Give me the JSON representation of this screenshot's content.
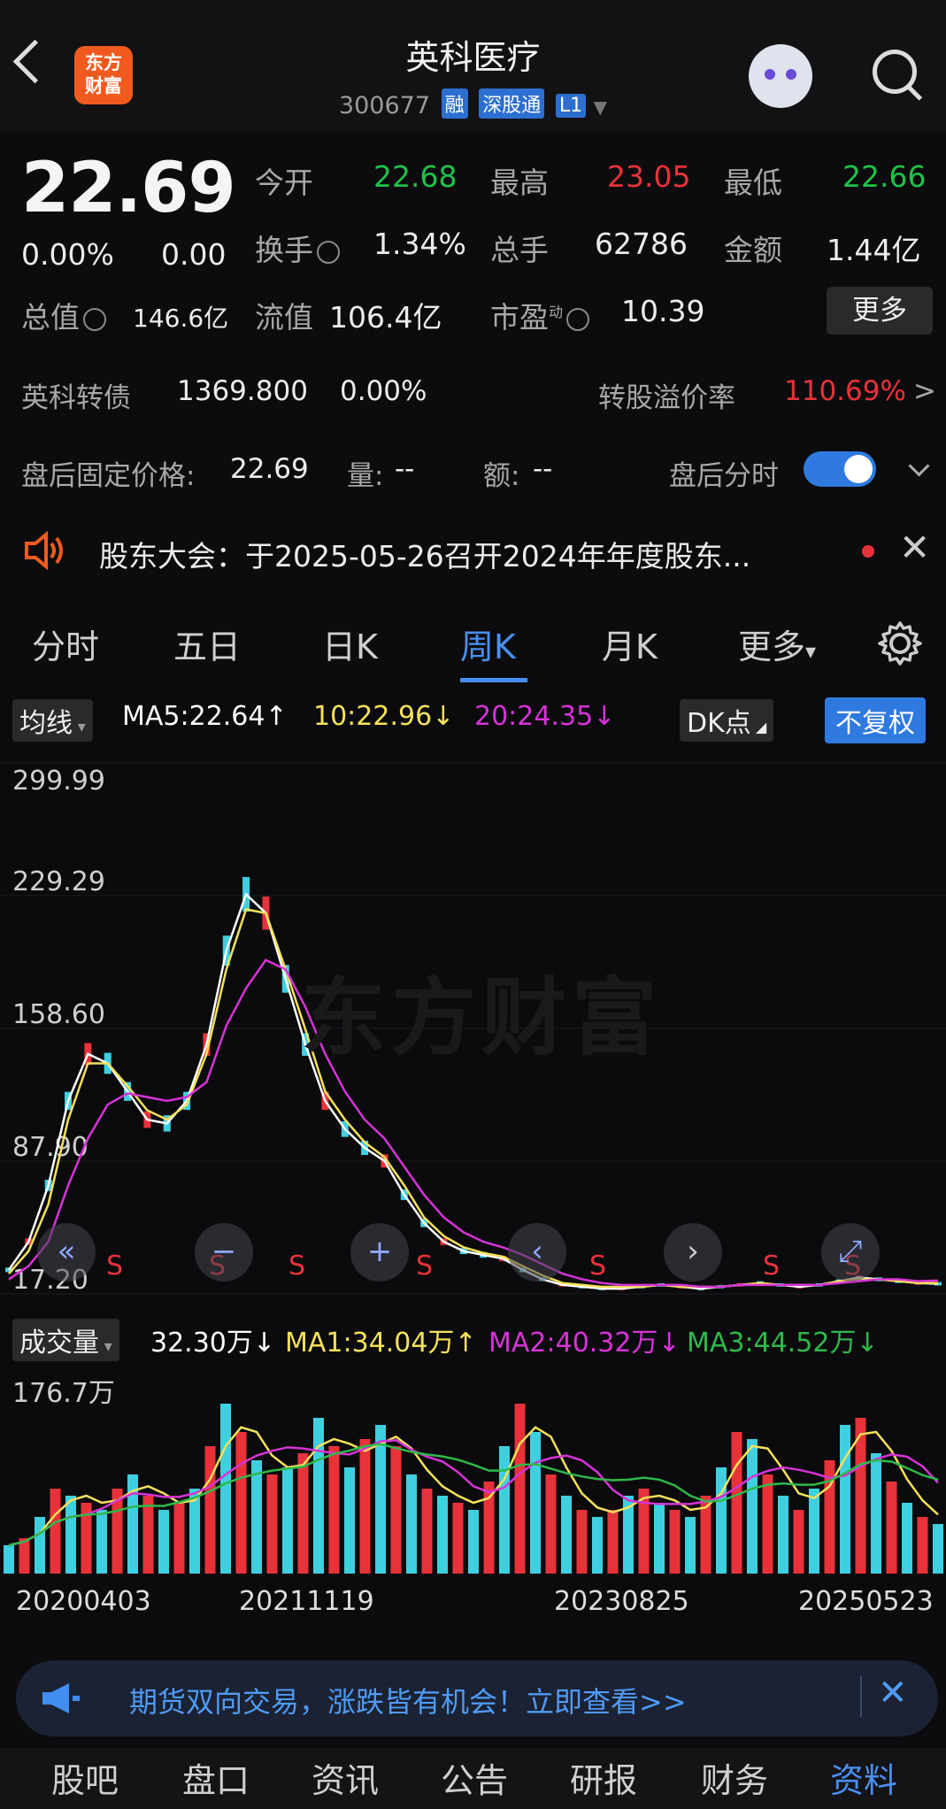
{
  "header": {
    "title": "英科医疗",
    "code": "300677",
    "tags": [
      "融",
      "深股通",
      "L1"
    ],
    "logo_line1": "东方",
    "logo_line2": "财富"
  },
  "quote": {
    "price": "22.69",
    "change_pct": "0.00%",
    "change": "0.00",
    "open_label": "今开",
    "open": "22.68",
    "high_label": "最高",
    "high": "23.05",
    "low_label": "最低",
    "low": "22.66",
    "turnover_label": "换手",
    "turnover": "1.34%",
    "volume_label": "总手",
    "volume": "62786",
    "amount_label": "金额",
    "amount": "1.44亿",
    "mktcap_label": "总值",
    "mktcap": "146.6亿",
    "float_label": "流值",
    "float": "106.4亿",
    "pe_label": "市盈",
    "pe_sup": "动",
    "pe": "10.39",
    "more": "更多"
  },
  "bond": {
    "name": "英科转债",
    "price": "1369.800",
    "pct": "0.00%",
    "premium_label": "转股溢价率",
    "premium": "110.69%",
    "arrow": ">"
  },
  "afterhours": {
    "price_label": "盘后固定价格:",
    "price": "22.69",
    "vol_label": "量:",
    "vol": "--",
    "amt_label": "额:",
    "amt": "--",
    "minute_label": "盘后分时"
  },
  "notice": {
    "text": "股东大会：于2025-05-26召开2024年年度股东..."
  },
  "tabs": [
    "分时",
    "五日",
    "日K",
    "周K",
    "月K",
    "更多"
  ],
  "active_tab": "周K",
  "tab_more_arrow": "▾",
  "chart_header": {
    "indicator": "均线",
    "ma5": "MA5:22.64↑",
    "ma10": "10:22.96↓",
    "ma20": "20:24.35↓",
    "dk": "DK点",
    "adjust": "不复权"
  },
  "vol_header": {
    "indicator": "成交量",
    "vol": "32.30万↓",
    "ma1": "MA1:34.04万↑",
    "ma2": "MA2:40.32万↓",
    "ma3": "MA3:44.52万↓"
  },
  "colors": {
    "up": "#e8323a",
    "down": "#3fd0e0",
    "ma5": "#ffffff",
    "ma10": "#f5e15a",
    "ma20": "#d633d6",
    "ma3": "#2fb84a",
    "accent": "#2f7ae0"
  },
  "chart_data": {
    "type": "line",
    "title": "",
    "y_ticks": [
      "299.99",
      "229.29",
      "158.60",
      "87.90",
      "17.20"
    ],
    "ylim": [
      17.2,
      299.99
    ],
    "x_dates": [
      "20200403",
      "20211119",
      "20230825",
      "20250523"
    ],
    "series": [
      {
        "name": "MA5",
        "values": [
          30,
          45,
          75,
          120,
          145,
          140,
          125,
          110,
          108,
          120,
          150,
          200,
          230,
          220,
          185,
          150,
          120,
          105,
          95,
          88,
          70,
          55,
          45,
          40,
          38,
          36,
          30,
          25,
          22,
          21,
          20,
          20,
          21,
          22,
          21,
          20,
          21,
          22,
          23,
          22,
          21,
          22,
          24,
          26,
          25,
          24,
          23,
          22.6
        ]
      },
      {
        "name": "10",
        "values": [
          28,
          40,
          65,
          110,
          140,
          140,
          128,
          115,
          110,
          118,
          145,
          190,
          222,
          220,
          190,
          158,
          125,
          110,
          98,
          90,
          75,
          58,
          48,
          42,
          39,
          37,
          32,
          27,
          23,
          22,
          21,
          21,
          21,
          22,
          21,
          21,
          21,
          22,
          23,
          22,
          22,
          22,
          24,
          25,
          25,
          24,
          23,
          23
        ]
      },
      {
        "name": "20",
        "values": [
          25,
          32,
          45,
          75,
          100,
          118,
          124,
          122,
          120,
          122,
          130,
          160,
          180,
          195,
          190,
          170,
          145,
          125,
          110,
          100,
          85,
          70,
          58,
          50,
          45,
          42,
          38,
          33,
          28,
          25,
          23,
          22,
          22,
          22,
          22,
          21,
          21,
          22,
          22,
          22,
          22,
          22,
          23,
          24,
          25,
          25,
          24,
          24.3
        ]
      }
    ],
    "volume": {
      "ytick": "176.7万",
      "values": [
        20,
        25,
        40,
        60,
        55,
        50,
        45,
        60,
        70,
        55,
        45,
        50,
        60,
        90,
        120,
        100,
        80,
        70,
        75,
        85,
        110,
        90,
        75,
        95,
        105,
        90,
        70,
        60,
        55,
        50,
        45,
        65,
        90,
        120,
        100,
        70,
        55,
        45,
        40,
        45,
        55,
        60,
        50,
        45,
        40,
        55,
        75,
        100,
        95,
        70,
        55,
        45,
        60,
        80,
        105,
        110,
        85,
        65,
        50,
        40,
        35
      ],
      "ma1_label": "MA1",
      "ma2_label": "MA2",
      "ma3_label": "MA3"
    }
  },
  "chart_markers": [
    "S",
    "S",
    "S",
    "S",
    "S",
    "S",
    "S"
  ],
  "banner": {
    "text": "期货双向交易，涨跌皆有机会！立即查看>>"
  },
  "bottom_tabs": [
    "股吧",
    "盘口",
    "资讯",
    "公告",
    "研报",
    "财务",
    "资料"
  ],
  "watermark": "东方财富"
}
